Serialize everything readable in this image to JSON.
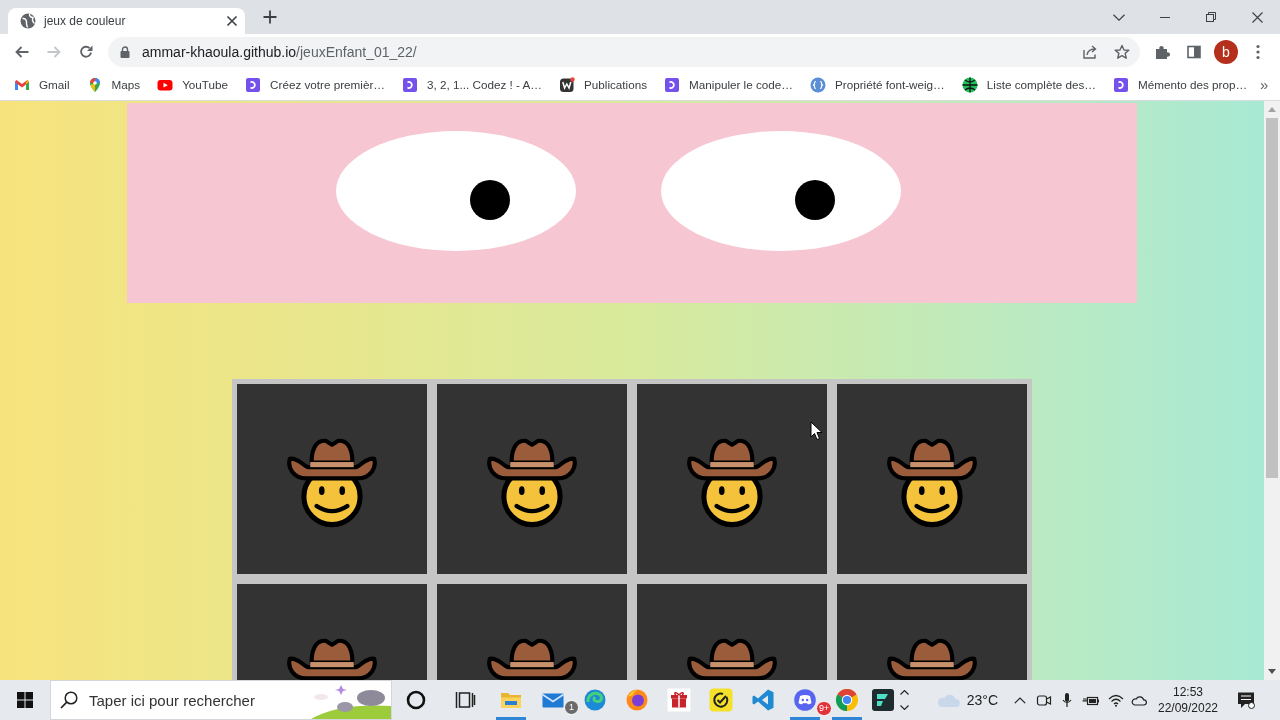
{
  "browser": {
    "tabs": [
      {
        "title": "jeux de couleur",
        "selected": true
      }
    ],
    "nav": [
      {
        "kind": "back",
        "disabled": false
      },
      {
        "kind": "forward",
        "disabled": true
      },
      {
        "kind": "reload",
        "disabled": false
      }
    ],
    "address": {
      "host": "ammar-khaoula.github.io",
      "path": "/jeuxEnfant_01_22/"
    },
    "profile_initial": "b",
    "bookmarks": [
      {
        "label": "Gmail",
        "kind": "gmail"
      },
      {
        "label": "Maps",
        "kind": "maps"
      },
      {
        "label": "YouTube",
        "kind": "youtube"
      },
      {
        "label": "Créez votre premièr…",
        "kind": "openclassrooms"
      },
      {
        "label": "3, 2, 1... Codez ! - A…",
        "kind": "openclassrooms"
      },
      {
        "label": "Publications",
        "kind": "w"
      },
      {
        "label": "Manipuler le code…",
        "kind": "openclassrooms"
      },
      {
        "label": "Propriété font-weig…",
        "kind": "css"
      },
      {
        "label": "Liste complète des…",
        "kind": "globe"
      },
      {
        "label": "Mémento des prop…",
        "kind": "openclassrooms"
      }
    ],
    "bookmarks_more": "»"
  },
  "page": {
    "tiles": [
      {
        "kind": "cowboy"
      },
      {
        "kind": "cowboy"
      },
      {
        "kind": "cowboy"
      },
      {
        "kind": "cowboy"
      },
      {
        "kind": "cowboy"
      },
      {
        "kind": "cowboy"
      },
      {
        "kind": "cowboy"
      },
      {
        "kind": "cowboy"
      }
    ]
  },
  "taskbar": {
    "search": {
      "placeholder": "Taper ici pour rechercher"
    },
    "apps": [
      {
        "kind": "cortana",
        "running": false
      },
      {
        "kind": "task-view",
        "running": false
      },
      {
        "kind": "file-explorer",
        "running": true
      },
      {
        "kind": "mail",
        "running": false,
        "badge": "1"
      },
      {
        "kind": "edge",
        "running": false
      },
      {
        "kind": "firefox",
        "running": false
      },
      {
        "kind": "gift",
        "running": false
      },
      {
        "kind": "tick",
        "running": false
      },
      {
        "kind": "vscode",
        "running": false
      },
      {
        "kind": "discord",
        "running": true,
        "badge": "9+"
      },
      {
        "kind": "chrome",
        "running": true
      },
      {
        "kind": "filmora",
        "running": false
      }
    ],
    "weather": {
      "temperature": "23°C"
    },
    "clock": {
      "time": "12:53",
      "date": "22/09/2022"
    }
  }
}
